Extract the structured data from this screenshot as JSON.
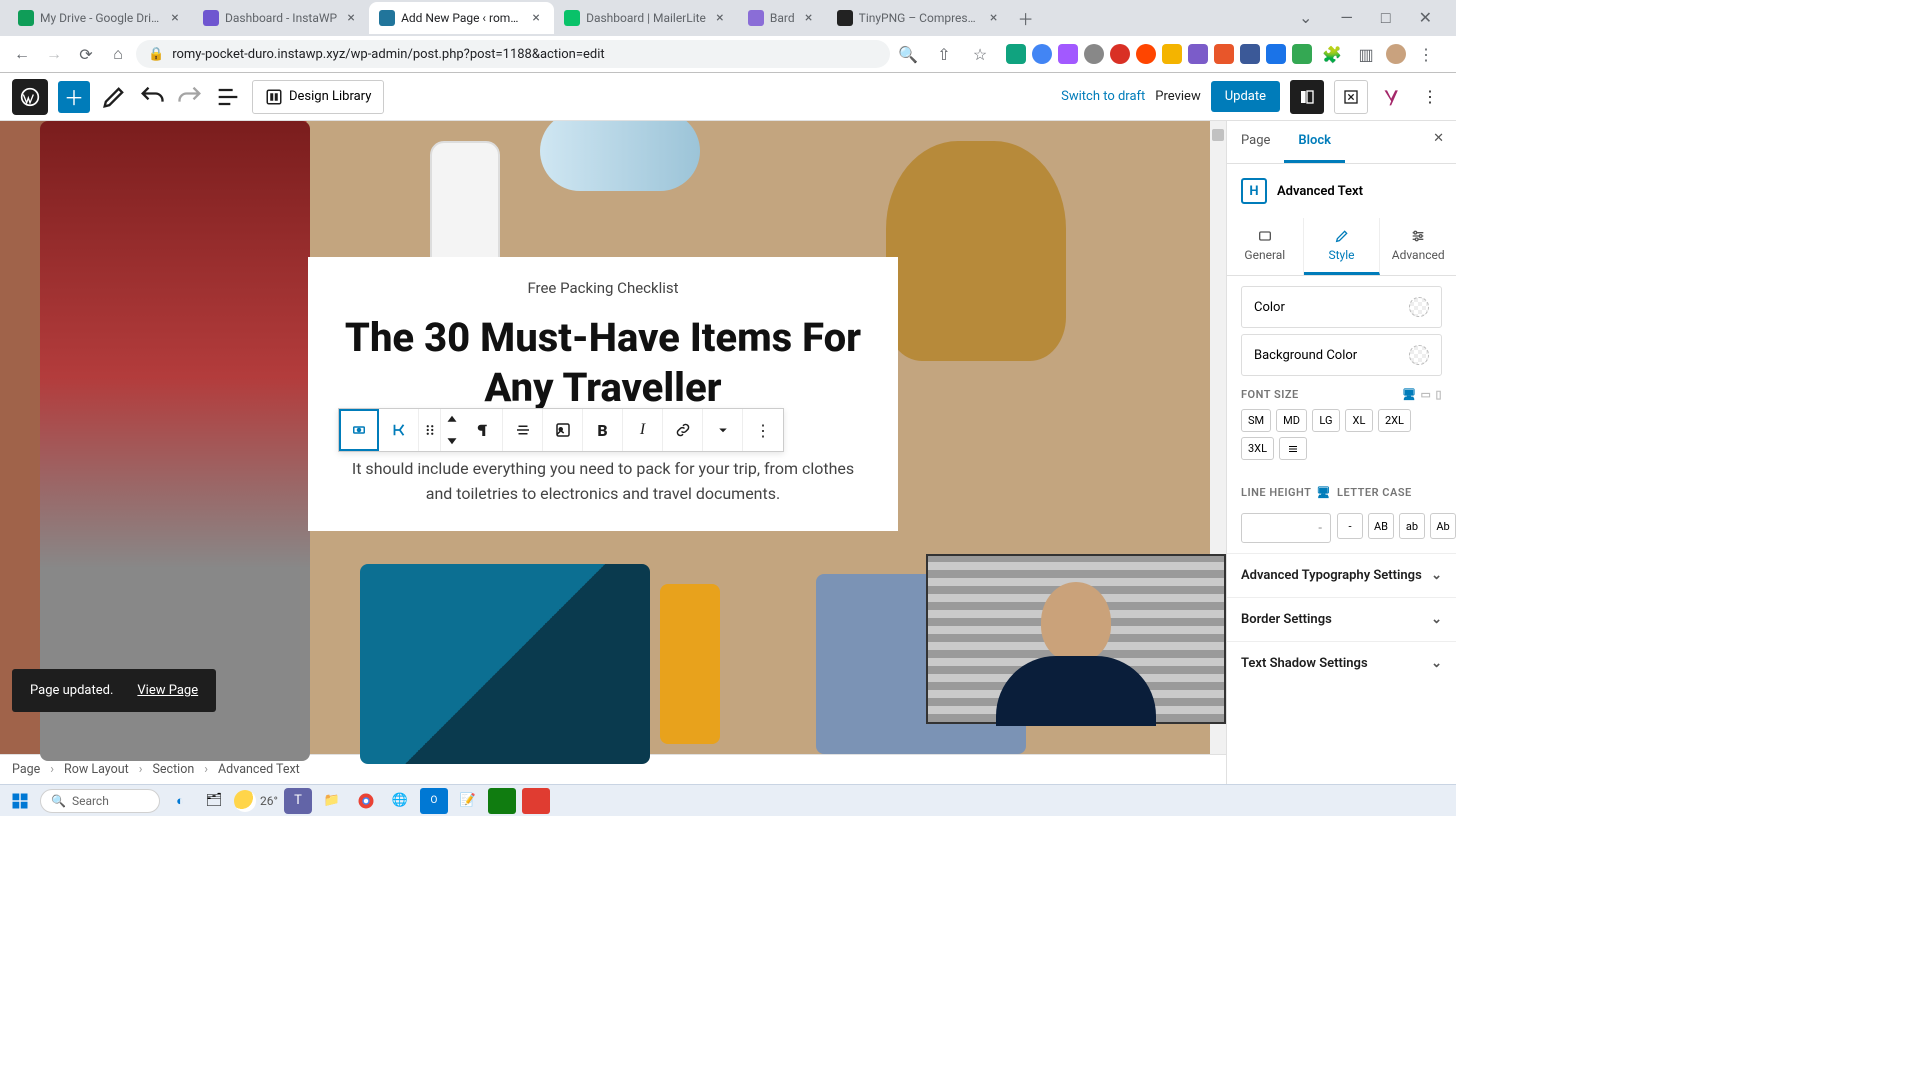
{
  "browser": {
    "tabs": [
      {
        "title": "My Drive - Google Drive",
        "favicon": "#0f9d58"
      },
      {
        "title": "Dashboard - InstaWP",
        "favicon": "#6f56d0"
      },
      {
        "title": "Add New Page ‹ romy-pocket-d",
        "favicon": "#21759b",
        "active": true
      },
      {
        "title": "Dashboard | MailerLite",
        "favicon": "#09c269"
      },
      {
        "title": "Bard",
        "favicon": "#8a6dd7"
      },
      {
        "title": "TinyPNG – Compress WebP, PNG",
        "favicon": "#222"
      }
    ],
    "url": "romy-pocket-duro.instawp.xyz/wp-admin/post.php?post=1188&action=edit"
  },
  "wp_toolbar": {
    "design_library": "Design Library",
    "switch_to_draft": "Switch to draft",
    "preview": "Preview",
    "update": "Update"
  },
  "content": {
    "eyebrow": "Free Packing Checklist",
    "title": "The 30 Must-Have Items For Any Traveller",
    "body": "It should include everything you need to pack for your trip, from clothes and toiletries to electronics and travel documents."
  },
  "snackbar": {
    "message": "Page updated.",
    "action": "View Page"
  },
  "breadcrumbs": [
    "Page",
    "Row Layout",
    "Section",
    "Advanced Text"
  ],
  "inspector": {
    "tabs": {
      "page": "Page",
      "block": "Block"
    },
    "block_name": "Advanced Text",
    "subtabs": {
      "general": "General",
      "style": "Style",
      "advanced": "Advanced"
    },
    "color_label": "Color",
    "bgcolor_label": "Background Color",
    "font_size_label": "FONT SIZE",
    "sizes": [
      "SM",
      "MD",
      "LG",
      "XL",
      "2XL",
      "3XL"
    ],
    "line_height_label": "LINE HEIGHT",
    "line_height_placeholder": "-",
    "letter_case_label": "LETTER CASE",
    "cases": [
      "-",
      "AB",
      "ab",
      "Ab"
    ],
    "accordions": [
      "Advanced Typography Settings",
      "Border Settings",
      "Text Shadow Settings"
    ]
  },
  "taskbar": {
    "search_placeholder": "Search",
    "weather_temp": "26°"
  }
}
